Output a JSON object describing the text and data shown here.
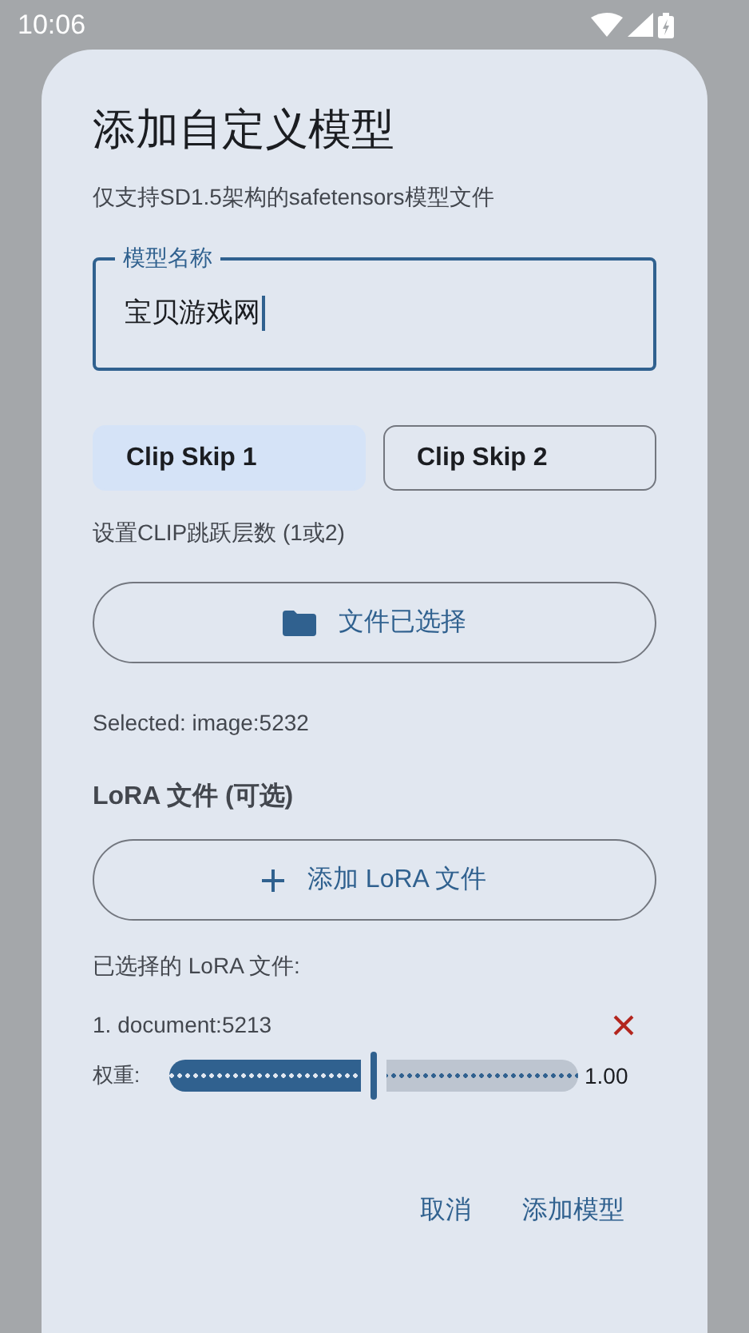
{
  "status_bar": {
    "time": "10:06"
  },
  "dialog": {
    "title": "添加自定义模型",
    "subtitle": "仅支持SD1.5架构的safetensors模型文件",
    "name_field": {
      "label": "模型名称",
      "value": "宝贝游戏网",
      "focused": true
    },
    "clip_skip": [
      {
        "label": "Clip Skip 1",
        "selected": true
      },
      {
        "label": "Clip Skip 2",
        "selected": false
      }
    ],
    "clip_hint": "设置CLIP跳跃层数 (1或2)",
    "file_button": {
      "label": "文件已选择"
    },
    "selected_file": "Selected: image:5232",
    "lora_heading": "LoRA 文件 (可选)",
    "add_lora_button": {
      "label": "添加 LoRA 文件"
    },
    "lora_list_heading": "已选择的 LoRA 文件:",
    "lora_files": [
      {
        "name": "1. document:5213",
        "weight_label": "权重:",
        "level": 0.5,
        "reading": "1.00"
      }
    ],
    "actions": [
      {
        "label": "取消"
      },
      {
        "label": "添加模型"
      }
    ]
  }
}
